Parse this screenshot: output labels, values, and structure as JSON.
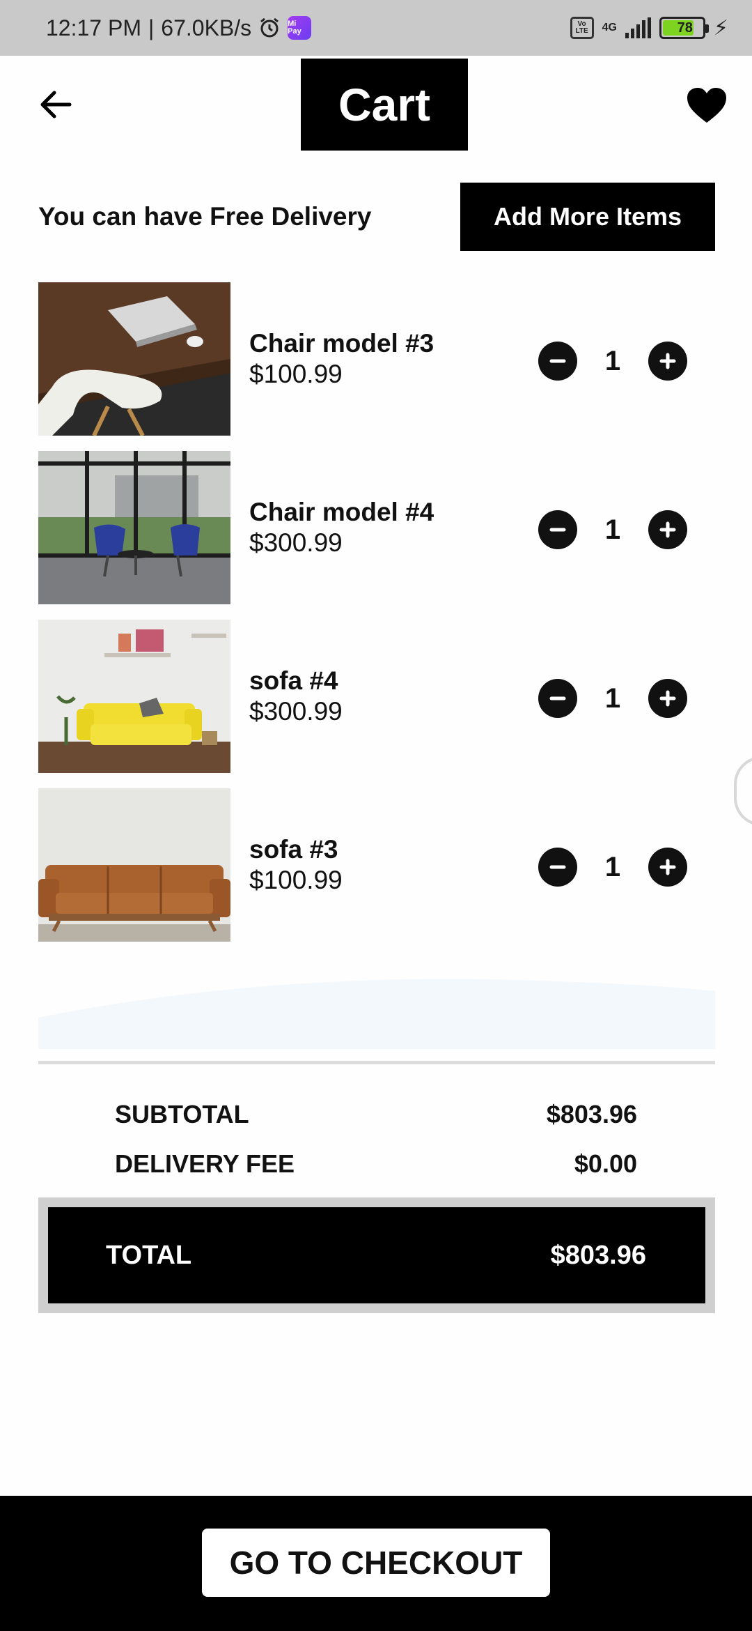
{
  "status_bar": {
    "time": "12:17 PM",
    "separator": "|",
    "net_speed": "67.0KB/s",
    "volte_top": "Vo",
    "volte_bottom": "LTE",
    "network": "4G",
    "battery": "78",
    "mipay_label": "Mi Pay"
  },
  "header": {
    "title": "Cart",
    "back_icon": "arrow-left-icon",
    "favorite_icon": "heart-icon"
  },
  "delivery": {
    "message": "You can have Free Delivery",
    "add_more_label": "Add More Items"
  },
  "items": [
    {
      "name": "Chair model #3",
      "price": "$100.99",
      "quantity": "1",
      "image": "desk-chair-laptop"
    },
    {
      "name": "Chair model #4",
      "price": "$300.99",
      "quantity": "1",
      "image": "blue-lounge-chairs"
    },
    {
      "name": "sofa #4",
      "price": "$300.99",
      "quantity": "1",
      "image": "yellow-sofa"
    },
    {
      "name": "sofa #3",
      "price": "$100.99",
      "quantity": "1",
      "image": "leather-sofa"
    }
  ],
  "summary": {
    "subtotal_label": "SUBTOTAL",
    "subtotal_value": "$803.96",
    "delivery_label": "DELIVERY FEE",
    "delivery_value": "$0.00",
    "total_label": "TOTAL",
    "total_value": "$803.96"
  },
  "checkout": {
    "label": "GO TO CHECKOUT"
  },
  "colors": {
    "primary": "#000000",
    "background": "#fdfefd",
    "status_bar": "#c9c9c9",
    "battery": "#7ed321"
  }
}
